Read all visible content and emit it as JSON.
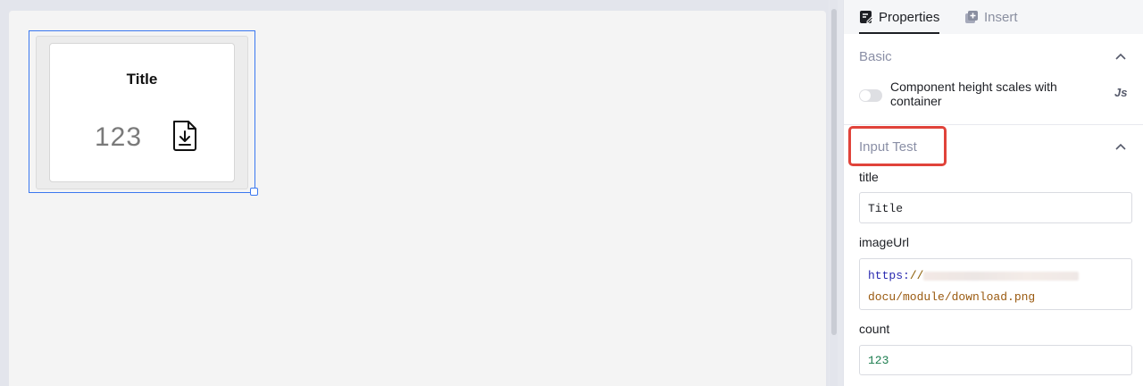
{
  "canvas": {
    "component": {
      "title": "Title",
      "count": "123",
      "icon": "file-download-icon"
    }
  },
  "panel": {
    "tabs": [
      {
        "label": "Properties",
        "icon": "edit-doc-icon",
        "active": true
      },
      {
        "label": "Insert",
        "icon": "add-square-icon",
        "active": false
      }
    ],
    "basic": {
      "heading": "Basic",
      "toggle_label": "Component height scales with container",
      "toggle_on": false,
      "js_label": "Js"
    },
    "input_test": {
      "heading": "Input Test",
      "fields": {
        "title": {
          "label": "title",
          "value": "Title"
        },
        "imageUrl": {
          "label": "imageUrl",
          "value_proto": "https:",
          "value_slash": "//",
          "value_path": "docu/module/download.png"
        },
        "count": {
          "label": "count",
          "value": "123"
        }
      }
    }
  },
  "colors": {
    "selection": "#3b78f0",
    "highlight": "#e0433a",
    "section_heading": "#8a8fa6"
  }
}
